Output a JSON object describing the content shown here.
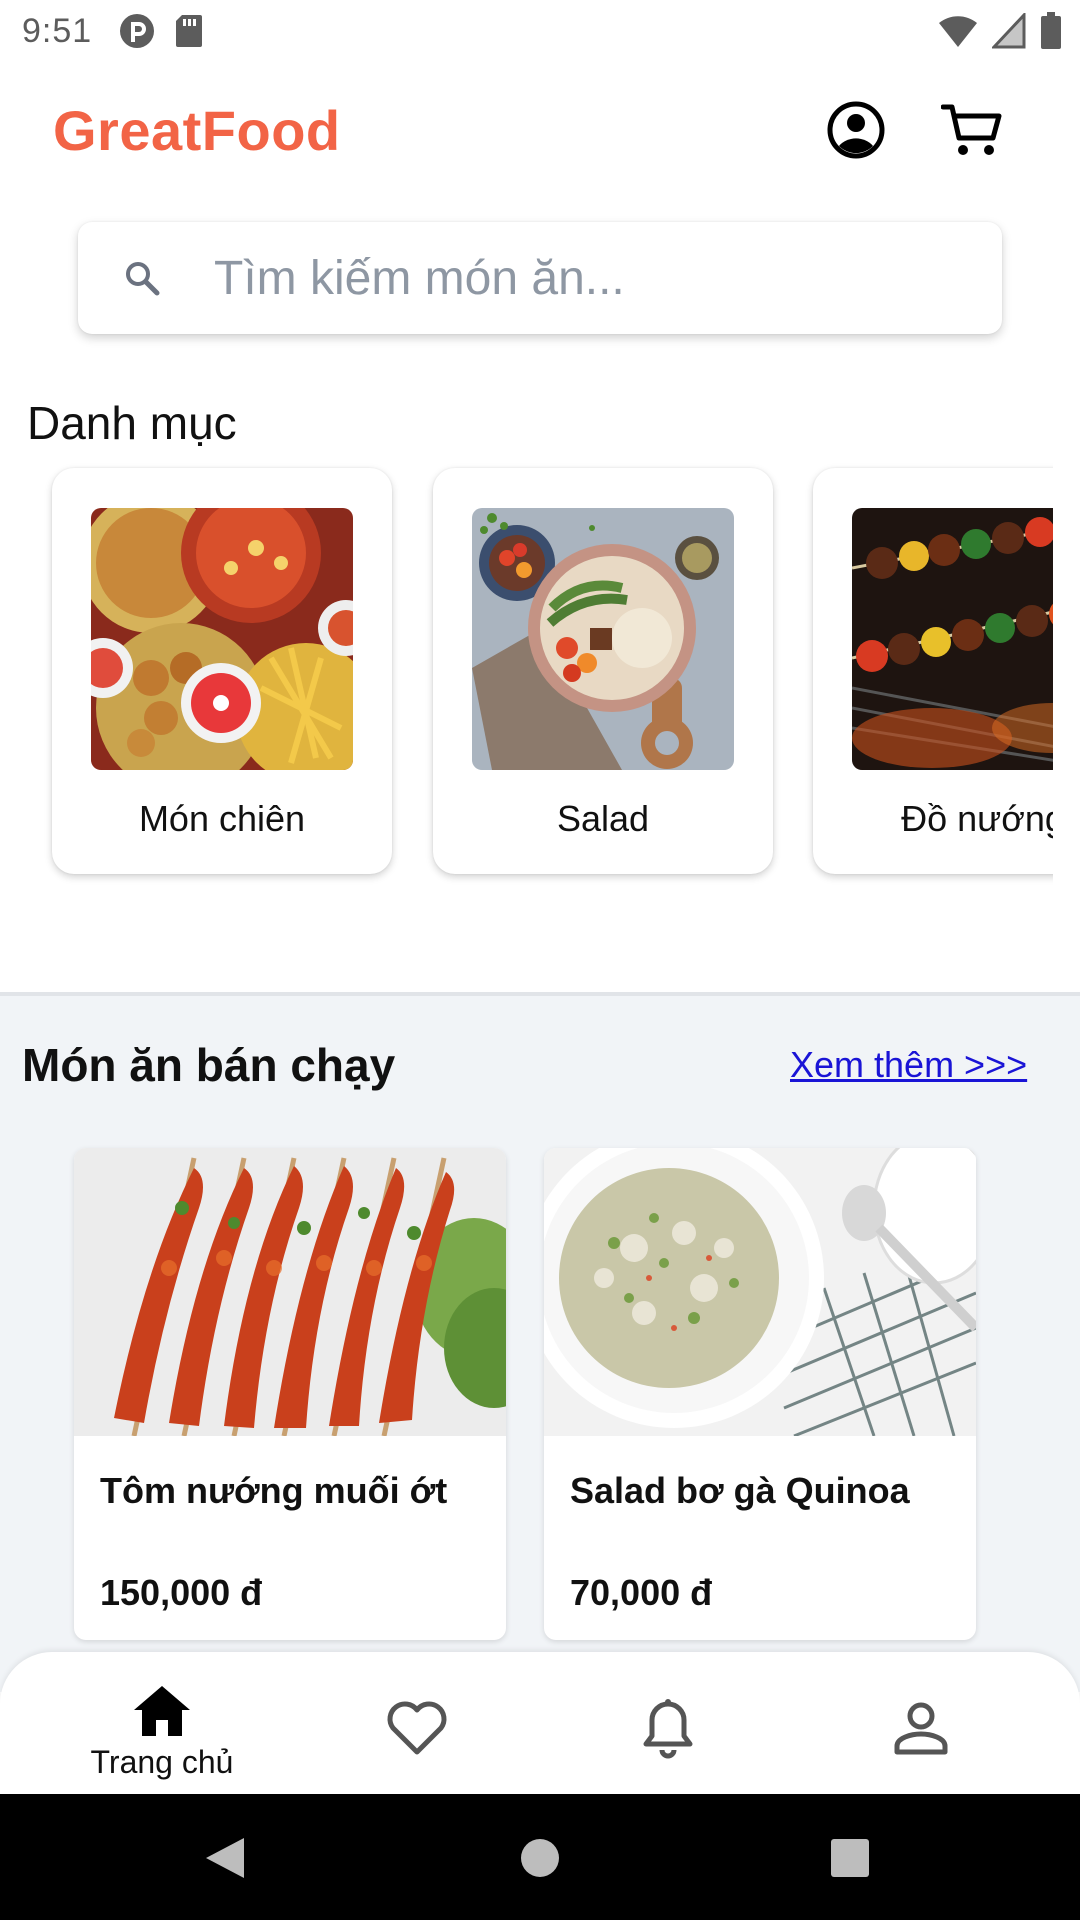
{
  "status_bar": {
    "time": "9:51",
    "left_icons": [
      "data-saver-icon",
      "sd-card-icon"
    ],
    "right_icons": [
      "wifi-icon",
      "signal-icon",
      "battery-icon"
    ]
  },
  "header": {
    "title": "GreatFood",
    "brand_color": "#f26446",
    "icons": [
      "account-icon",
      "cart-icon"
    ]
  },
  "search": {
    "placeholder": "Tìm kiếm món ăn...",
    "value": ""
  },
  "categories": {
    "title": "Danh mục",
    "items": [
      {
        "label": "Món chiên",
        "image": "fried-food-photo"
      },
      {
        "label": "Salad",
        "image": "salad-photo"
      },
      {
        "label": "Đồ nướng",
        "image": "bbq-skewers-photo"
      }
    ]
  },
  "best_sellers": {
    "title": "Món ăn bán chạy",
    "see_more": "Xem thêm >>> ",
    "products": [
      {
        "name": "Tôm nướng muối ớt",
        "price": "150,000 đ",
        "image": "grilled-shrimp-photo"
      },
      {
        "name": "Salad bơ gà Quinoa",
        "price": "70,000 đ",
        "image": "quinoa-salad-photo"
      }
    ]
  },
  "bottom_nav": {
    "items": [
      {
        "label": "Trang chủ",
        "icon": "home-icon",
        "active": true
      },
      {
        "label": "",
        "icon": "heart-icon",
        "active": false
      },
      {
        "label": "",
        "icon": "bell-icon",
        "active": false
      },
      {
        "label": "",
        "icon": "person-icon",
        "active": false
      }
    ]
  },
  "system_nav": {
    "icons": [
      "back-icon",
      "home-circle-icon",
      "recents-icon"
    ]
  }
}
